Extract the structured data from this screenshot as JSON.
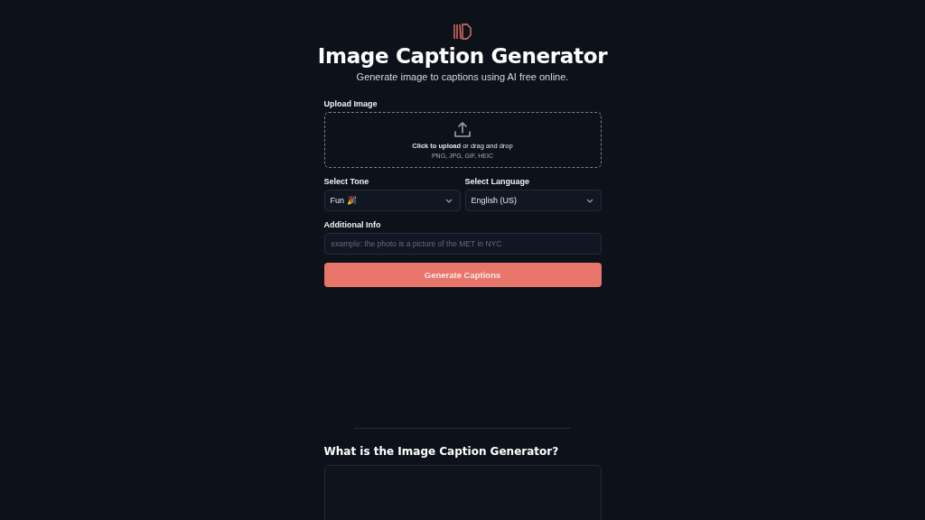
{
  "title": "Image Caption Generator",
  "subtitle": "Generate image to captions using AI free online.",
  "upload": {
    "label": "Upload Image",
    "prompt": "**Click to upload** or drag and drop",
    "formats": "PNG, JPG, GIF, HEIC"
  },
  "selects": [
    {
      "label": "Select Tone",
      "value": "Fun 🎉"
    },
    {
      "label": "Select Language",
      "value": "English (US)"
    }
  ],
  "additional_info": {
    "label": "Additional Info",
    "placeholder": "example: the photo is a picture of the MET in NYC"
  },
  "button": "Generate Captions",
  "section": {
    "heading": "What is the Image Caption Generator?"
  }
}
